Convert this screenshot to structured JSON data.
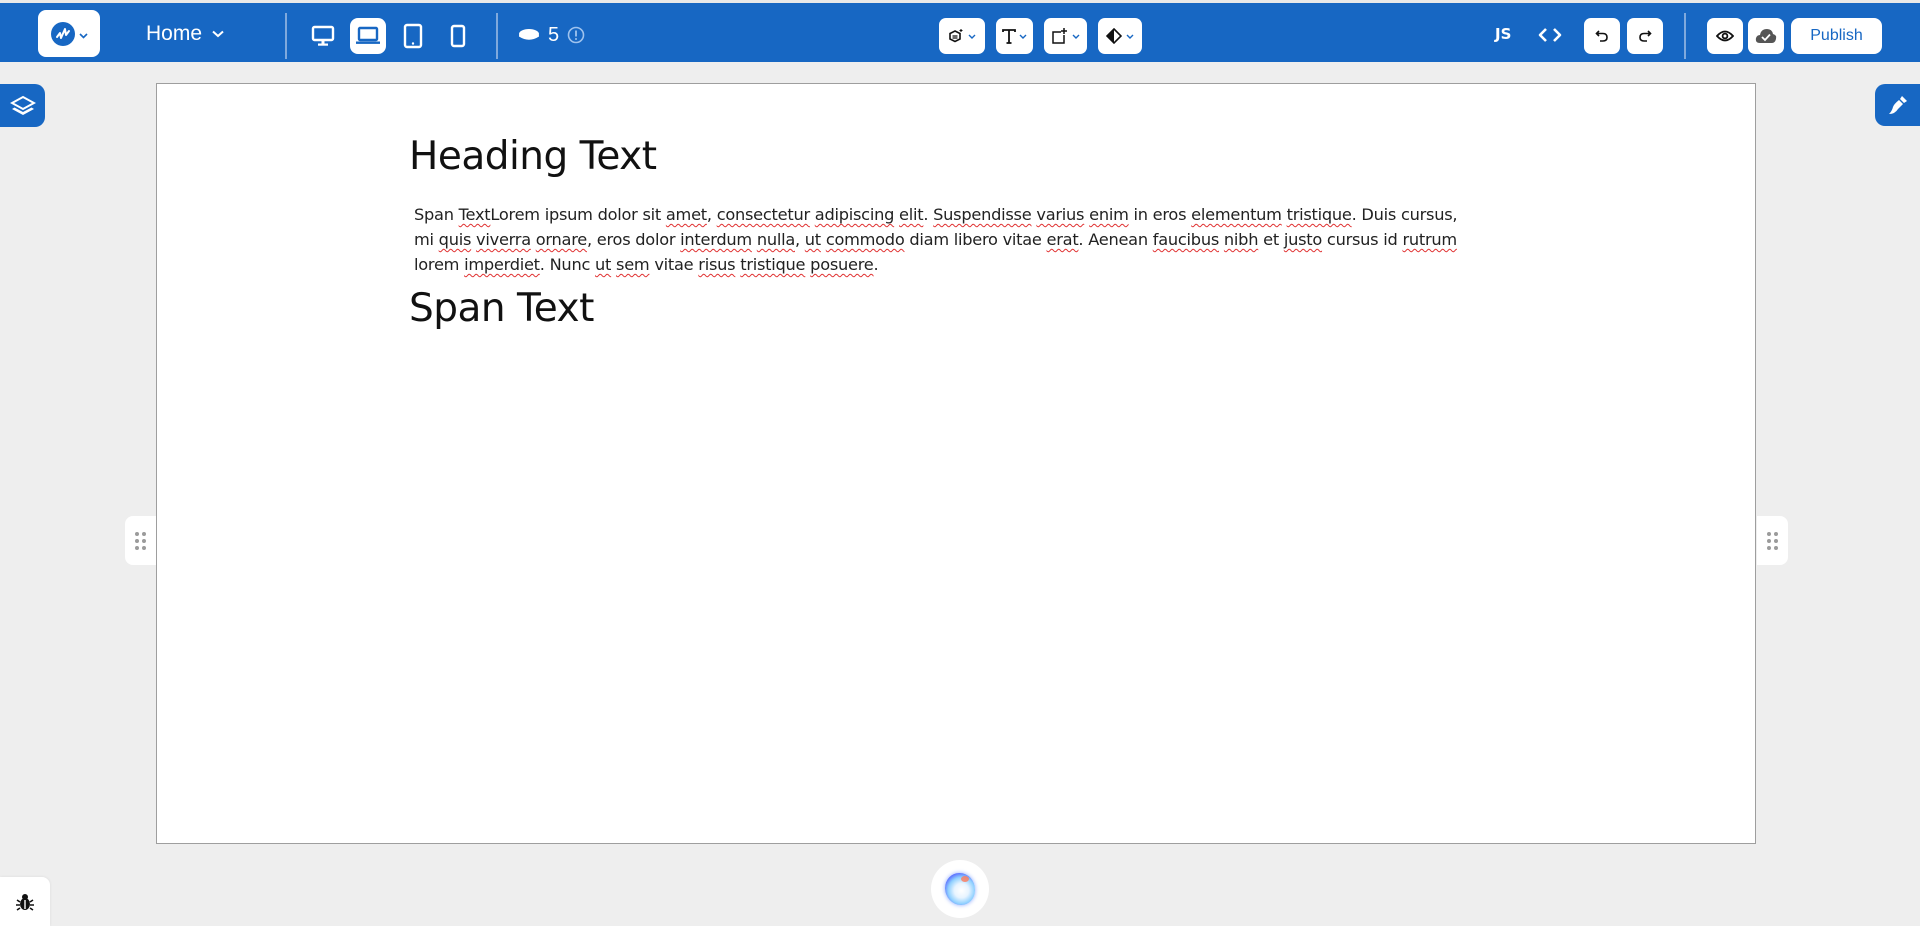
{
  "topbar": {
    "logo_icon": "brand-logo-icon",
    "page_selector": {
      "label": "Home"
    },
    "devices": [
      {
        "name": "desktop",
        "icon": "desktop-icon",
        "active": false
      },
      {
        "name": "laptop",
        "icon": "laptop-icon",
        "active": true
      },
      {
        "name": "tablet",
        "icon": "tablet-icon",
        "active": false
      },
      {
        "name": "mobile",
        "icon": "mobile-icon",
        "active": false
      }
    ],
    "credits": {
      "icon": "coin-icon",
      "count": "5",
      "info_icon": "info-icon"
    },
    "tools": [
      {
        "name": "components",
        "icon": "cube-add-icon"
      },
      {
        "name": "typography",
        "icon": "text-icon"
      },
      {
        "name": "add-element",
        "icon": "square-plus-icon"
      },
      {
        "name": "color",
        "icon": "contrast-fill-icon"
      }
    ],
    "js_label": "JS",
    "code_icon": "code-icon",
    "undo_icon": "undo-icon",
    "redo_icon": "redo-icon",
    "preview_icon": "eye-icon",
    "save_icon": "cloud-check-icon",
    "publish_label": "Publish"
  },
  "canvas": {
    "heading": "Heading Text",
    "paragraph": [
      {
        "t": "Span ",
        "s": false
      },
      {
        "t": "Text",
        "s": true
      },
      {
        "t": "Lorem ipsum dolor sit ",
        "s": false
      },
      {
        "t": "amet",
        "s": true
      },
      {
        "t": ", ",
        "s": false
      },
      {
        "t": "consectetur",
        "s": true
      },
      {
        "t": " ",
        "s": false
      },
      {
        "t": "adipiscing",
        "s": true
      },
      {
        "t": " ",
        "s": false
      },
      {
        "t": "elit",
        "s": true
      },
      {
        "t": ". ",
        "s": false
      },
      {
        "t": "Suspendisse",
        "s": true
      },
      {
        "t": " ",
        "s": false
      },
      {
        "t": "varius",
        "s": true
      },
      {
        "t": " ",
        "s": false
      },
      {
        "t": "enim",
        "s": true
      },
      {
        "t": " in eros ",
        "s": false
      },
      {
        "t": "elementum",
        "s": true
      },
      {
        "t": " ",
        "s": false
      },
      {
        "t": "tristique",
        "s": true
      },
      {
        "t": ". Duis cursus, mi ",
        "s": false
      },
      {
        "t": "quis",
        "s": true
      },
      {
        "t": " ",
        "s": false
      },
      {
        "t": "viverra",
        "s": true
      },
      {
        "t": " ",
        "s": false
      },
      {
        "t": "ornare",
        "s": true
      },
      {
        "t": ", eros dolor ",
        "s": false
      },
      {
        "t": "interdum",
        "s": true
      },
      {
        "t": " ",
        "s": false
      },
      {
        "t": "nulla",
        "s": true
      },
      {
        "t": ", ",
        "s": false
      },
      {
        "t": "ut",
        "s": true
      },
      {
        "t": " ",
        "s": false
      },
      {
        "t": "commodo",
        "s": true
      },
      {
        "t": " diam libero vitae ",
        "s": false
      },
      {
        "t": "erat",
        "s": true
      },
      {
        "t": ". Aenean ",
        "s": false
      },
      {
        "t": "faucibus",
        "s": true
      },
      {
        "t": " ",
        "s": false
      },
      {
        "t": "nibh",
        "s": true
      },
      {
        "t": " et ",
        "s": false
      },
      {
        "t": "justo",
        "s": true
      },
      {
        "t": " cursus id ",
        "s": false
      },
      {
        "t": "rutrum",
        "s": true
      },
      {
        "t": " lorem ",
        "s": false
      },
      {
        "t": "imperdiet",
        "s": true
      },
      {
        "t": ". Nunc ",
        "s": false
      },
      {
        "t": "ut",
        "s": true
      },
      {
        "t": " ",
        "s": false
      },
      {
        "t": "sem",
        "s": true
      },
      {
        "t": " vitae ",
        "s": false
      },
      {
        "t": "risus",
        "s": true
      },
      {
        "t": " ",
        "s": false
      },
      {
        "t": "tristique",
        "s": true
      },
      {
        "t": " ",
        "s": false
      },
      {
        "t": "posuere",
        "s": true
      },
      {
        "t": ".",
        "s": false
      }
    ],
    "span_text": "Span Text"
  },
  "side": {
    "layers_icon": "layers-icon",
    "style_icon": "brush-icon",
    "handle_icon": "drag-handle-icon",
    "ai_icon": "ai-orb-icon",
    "debug_icon": "bug-icon"
  },
  "colors": {
    "brand": "#1767c3",
    "spellcheck": "#e03030",
    "canvas_bg": "#ffffff",
    "workspace_bg": "#eeeeee"
  }
}
